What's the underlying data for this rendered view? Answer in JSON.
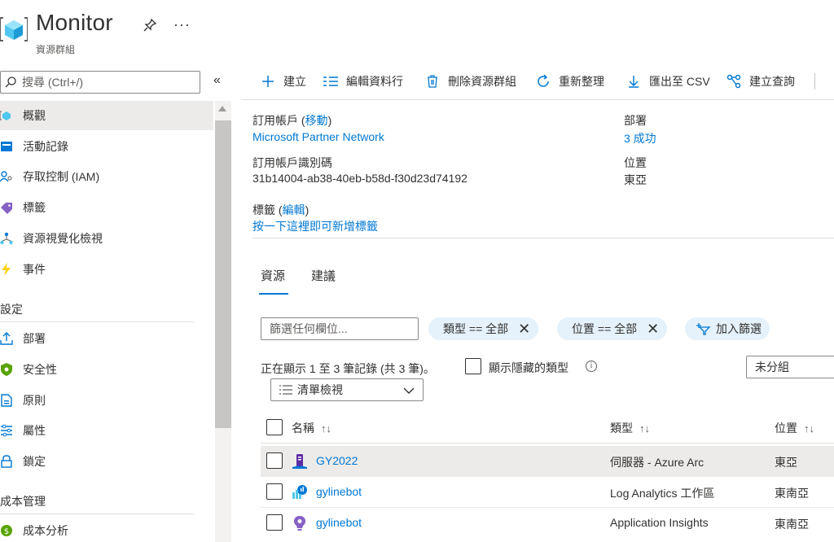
{
  "header": {
    "title": "Monitor",
    "subtitle": "資源群組"
  },
  "sidebar": {
    "search_placeholder": "搜尋 (Ctrl+/)",
    "items": [
      {
        "label": "概觀",
        "icon": "overview-icon"
      },
      {
        "label": "活動記錄",
        "icon": "activity-log-icon"
      },
      {
        "label": "存取控制 (IAM)",
        "icon": "iam-icon"
      },
      {
        "label": "標籤",
        "icon": "tag-icon"
      },
      {
        "label": "資源視覺化檢視",
        "icon": "visualizer-icon"
      },
      {
        "label": "事件",
        "icon": "lightning-icon"
      }
    ],
    "section_settings": "設定",
    "settings_items": [
      {
        "label": "部署",
        "icon": "deploy-icon"
      },
      {
        "label": "安全性",
        "icon": "shield-icon"
      },
      {
        "label": "原則",
        "icon": "policy-icon"
      },
      {
        "label": "屬性",
        "icon": "properties-icon"
      },
      {
        "label": "鎖定",
        "icon": "lock-icon"
      }
    ],
    "section_cost": "成本管理",
    "cost_items": [
      {
        "label": "成本分析",
        "icon": "cost-analysis-icon"
      }
    ]
  },
  "toolbar": {
    "create": "建立",
    "edit_columns": "編輯資料行",
    "delete_group": "刪除資源群組",
    "refresh": "重新整理",
    "export_csv": "匯出至 CSV",
    "create_query": "建立查詢"
  },
  "essentials": {
    "subscription_label": "訂用帳戶 (",
    "subscription_move": "移動",
    "subscription_label_end": ")",
    "subscription_value": "Microsoft Partner Network",
    "subscription_id_label": "訂用帳戶識別碼",
    "subscription_id_value": "31b14004-ab38-40eb-b58d-f30d23d74192",
    "deployments_label": "部署",
    "deployments_value": "3 成功",
    "location_label": "位置",
    "location_value": "東亞",
    "tags_label": "標籤 (",
    "tags_edit": "編輯",
    "tags_label_end": ")",
    "tags_add": "按一下這裡即可新增標籤"
  },
  "tabs": {
    "resources": "資源",
    "recommendations": "建議"
  },
  "filters": {
    "placeholder": "篩選任何欄位...",
    "type_pill": "類型 == 全部",
    "location_pill": "位置 == 全部",
    "add_filter": "加入篩選"
  },
  "list": {
    "records": "正在顯示 1 至 3 筆記錄 (共 3 筆)。",
    "show_hidden": "顯示隱藏的類型",
    "grouping": "未分組",
    "view": "清單檢視",
    "columns": {
      "name": "名稱",
      "type": "類型",
      "location": "位置"
    },
    "rows": [
      {
        "name": "GY2022",
        "type": "伺服器 - Azure Arc",
        "location": "東亞",
        "icon": "server-arc-icon"
      },
      {
        "name": "gylinebot",
        "type": "Log Analytics 工作區",
        "location": "東南亞",
        "icon": "log-analytics-icon"
      },
      {
        "name": "gylinebot",
        "type": "Application Insights",
        "location": "東南亞",
        "icon": "app-insights-icon"
      }
    ]
  },
  "colors": {
    "accent": "#0078d4",
    "selected_bg": "#edebe9",
    "pill_bg": "#e5f1fb"
  }
}
